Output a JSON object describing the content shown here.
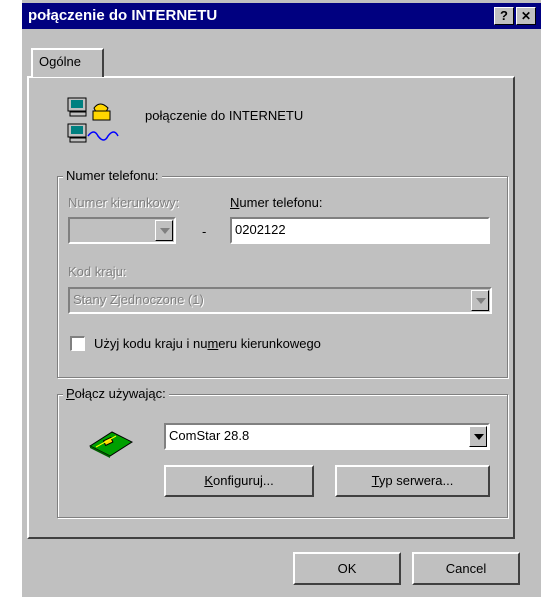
{
  "window": {
    "title": "połączenie do INTERNETU",
    "help_button": "?",
    "close_button": "✕"
  },
  "tabs": [
    {
      "label": "Ogólne",
      "active": true
    }
  ],
  "connection": {
    "icon": "dialup-connection-icon",
    "name": "połączenie do INTERNETU"
  },
  "phone_group": {
    "legend": "Numer telefonu:",
    "area_code_label": "Numer kierunkowy:",
    "area_code_value": "",
    "dash": "-",
    "phone_label": "Numer telefonu:",
    "phone_value": "0202122",
    "country_label": "Kod kraju:",
    "country_value": "Stany Zjednoczone (1)",
    "use_codes": {
      "label": "Użyj kodu kraju i numeru kierunkowego",
      "checked": false
    }
  },
  "connect_group": {
    "legend": "Połącz używając:",
    "modem_icon": "modem-icon",
    "modem_value": "ComStar 28.8",
    "configure_label": "Konfiguruj...",
    "server_type_label": "Typ serwera..."
  },
  "footer": {
    "ok_label": "OK",
    "cancel_label": "Cancel"
  }
}
